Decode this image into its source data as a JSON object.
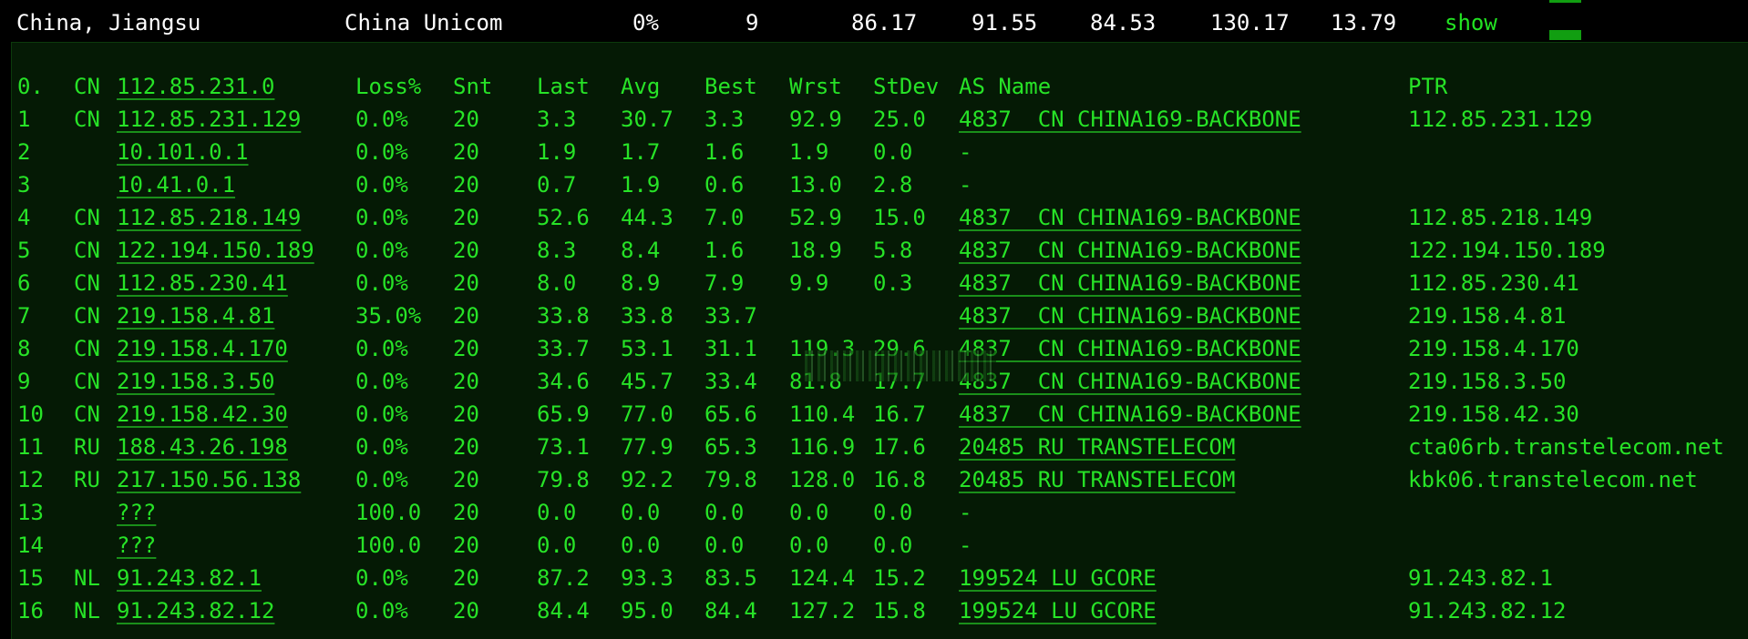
{
  "summary": {
    "location": "China, Jiangsu",
    "isp": "China Unicom",
    "loss": "0%",
    "hops": "9",
    "last": "86.17",
    "avg": "91.55",
    "best": "84.53",
    "worst": "130.17",
    "stdev": "13.79",
    "show_label": "show"
  },
  "colors": {
    "text": "#27e327",
    "background": "#051a05",
    "summary_text": "#ffffff",
    "bar": "#119e11"
  },
  "headers": {
    "idx": "0.",
    "cc": "CN",
    "host": "112.85.231.0",
    "loss": "Loss%",
    "snt": "Snt",
    "last": "Last",
    "avg": "Avg",
    "best": "Best",
    "wrst": "Wrst",
    "stdev": "StDev",
    "as": "AS Name",
    "ptr": "PTR"
  },
  "hops": [
    {
      "idx": "1",
      "cc": "CN",
      "host": "112.85.231.129",
      "loss": "0.0%",
      "snt": "20",
      "last": "3.3",
      "avg": "30.7",
      "best": "3.3",
      "wrst": "92.9",
      "stdev": "25.0",
      "as": "4837  CN CHINA169-BACKBONE",
      "ptr": "112.85.231.129"
    },
    {
      "idx": "2",
      "cc": "",
      "host": "10.101.0.1",
      "loss": "0.0%",
      "snt": "20",
      "last": "1.9",
      "avg": "1.7",
      "best": "1.6",
      "wrst": "1.9",
      "stdev": "0.0",
      "as": "-",
      "ptr": ""
    },
    {
      "idx": "3",
      "cc": "",
      "host": "10.41.0.1",
      "loss": "0.0%",
      "snt": "20",
      "last": "0.7",
      "avg": "1.9",
      "best": "0.6",
      "wrst": "13.0",
      "stdev": "2.8",
      "as": "-",
      "ptr": ""
    },
    {
      "idx": "4",
      "cc": "CN",
      "host": "112.85.218.149",
      "loss": "0.0%",
      "snt": "20",
      "last": "52.6",
      "avg": "44.3",
      "best": "7.0",
      "wrst": "52.9",
      "stdev": "15.0",
      "as": "4837  CN CHINA169-BACKBONE",
      "ptr": "112.85.218.149"
    },
    {
      "idx": "5",
      "cc": "CN",
      "host": "122.194.150.189",
      "loss": "0.0%",
      "snt": "20",
      "last": "8.3",
      "avg": "8.4",
      "best": "1.6",
      "wrst": "18.9",
      "stdev": "5.8",
      "as": "4837  CN CHINA169-BACKBONE",
      "ptr": "122.194.150.189"
    },
    {
      "idx": "6",
      "cc": "CN",
      "host": "112.85.230.41",
      "loss": "0.0%",
      "snt": "20",
      "last": "8.0",
      "avg": "8.9",
      "best": "7.9",
      "wrst": "9.9",
      "stdev": "0.3",
      "as": "4837  CN CHINA169-BACKBONE",
      "ptr": "112.85.230.41"
    },
    {
      "idx": "7",
      "cc": "CN",
      "host": "219.158.4.81",
      "loss": "35.0%",
      "snt": "20",
      "last": "33.8",
      "avg": "33.8",
      "best": "33.7",
      "wrst": "",
      "stdev": "",
      "as": "4837  CN CHINA169-BACKBONE",
      "ptr": "219.158.4.81"
    },
    {
      "idx": "8",
      "cc": "CN",
      "host": "219.158.4.170",
      "loss": "0.0%",
      "snt": "20",
      "last": "33.7",
      "avg": "53.1",
      "best": "31.1",
      "wrst": "119.3",
      "stdev": "29.6",
      "as": "4837  CN CHINA169-BACKBONE",
      "ptr": "219.158.4.170"
    },
    {
      "idx": "9",
      "cc": "CN",
      "host": "219.158.3.50",
      "loss": "0.0%",
      "snt": "20",
      "last": "34.6",
      "avg": "45.7",
      "best": "33.4",
      "wrst": "81.8",
      "stdev": "17.7",
      "as": "4837  CN CHINA169-BACKBONE",
      "ptr": "219.158.3.50"
    },
    {
      "idx": "10",
      "cc": "CN",
      "host": "219.158.42.30",
      "loss": "0.0%",
      "snt": "20",
      "last": "65.9",
      "avg": "77.0",
      "best": "65.6",
      "wrst": "110.4",
      "stdev": "16.7",
      "as": "4837  CN CHINA169-BACKBONE",
      "ptr": "219.158.42.30"
    },
    {
      "idx": "11",
      "cc": "RU",
      "host": "188.43.26.198",
      "loss": "0.0%",
      "snt": "20",
      "last": "73.1",
      "avg": "77.9",
      "best": "65.3",
      "wrst": "116.9",
      "stdev": "17.6",
      "as": "20485 RU TRANSTELECOM",
      "ptr": "cta06rb.transtelecom.net"
    },
    {
      "idx": "12",
      "cc": "RU",
      "host": "217.150.56.138",
      "loss": "0.0%",
      "snt": "20",
      "last": "79.8",
      "avg": "92.2",
      "best": "79.8",
      "wrst": "128.0",
      "stdev": "16.8",
      "as": "20485 RU TRANSTELECOM",
      "ptr": "kbk06.transtelecom.net"
    },
    {
      "idx": "13",
      "cc": "",
      "host": "???",
      "loss": "100.0",
      "snt": "20",
      "last": "0.0",
      "avg": "0.0",
      "best": "0.0",
      "wrst": "0.0",
      "stdev": "0.0",
      "as": "-",
      "ptr": ""
    },
    {
      "idx": "14",
      "cc": "",
      "host": "???",
      "loss": "100.0",
      "snt": "20",
      "last": "0.0",
      "avg": "0.0",
      "best": "0.0",
      "wrst": "0.0",
      "stdev": "0.0",
      "as": "-",
      "ptr": ""
    },
    {
      "idx": "15",
      "cc": "NL",
      "host": "91.243.82.1",
      "loss": "0.0%",
      "snt": "20",
      "last": "87.2",
      "avg": "93.3",
      "best": "83.5",
      "wrst": "124.4",
      "stdev": "15.2",
      "as": "199524 LU GCORE",
      "ptr": "91.243.82.1"
    },
    {
      "idx": "16",
      "cc": "NL",
      "host": "91.243.82.12",
      "loss": "0.0%",
      "snt": "20",
      "last": "84.4",
      "avg": "95.0",
      "best": "84.4",
      "wrst": "127.2",
      "stdev": "15.8",
      "as": "199524 LU GCORE",
      "ptr": "91.243.82.12"
    }
  ]
}
